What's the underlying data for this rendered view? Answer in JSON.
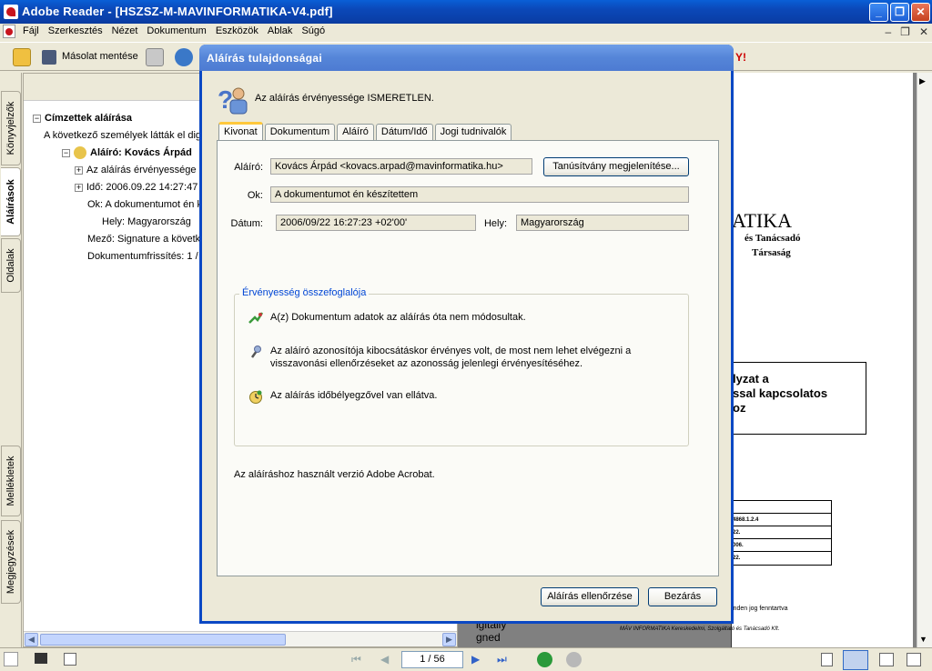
{
  "window": {
    "title": "Adobe Reader - [HSZSZ-M-MAVINFORMATIKA-V4.pdf]",
    "buttons": {
      "minimize": "_",
      "maximize": "❐",
      "close": "✕"
    }
  },
  "menu": {
    "items": [
      "Fájl",
      "Szerkesztés",
      "Nézet",
      "Dokumentum",
      "Eszközök",
      "Ablak",
      "Súgó"
    ],
    "right": [
      "–",
      "❐",
      "✕"
    ]
  },
  "toolbar": {
    "save_copy": "Másolat mentése"
  },
  "left_tabs": [
    "Könyvjelzők",
    "Aláírások",
    "Oldalak",
    "Mellékletek",
    "Megjegyzések"
  ],
  "signatures_panel": {
    "heading": "Címzettek aláírása",
    "intro": "A következő személyek látták el digi",
    "signer": "Aláíró: Kovács Árpád",
    "validity": "Az aláírás érvényessége i",
    "time": "Idő: 2006.09.22 14:27:47",
    "reason": "Ok: A dokumentumot én k",
    "location": "Hely: Magyarország",
    "field": "Mező: Signature a követk",
    "doc_revision": "Dokumentumfrissítés: 1 /"
  },
  "document_page": {
    "logo_text": "ATIKA",
    "sub1": "és Tanácsadó",
    "sub2": "Társaság",
    "box_l1": "lyzat a",
    "box_l2": "ssal kapcsolatos",
    "box_l3": "oz",
    "table_rows": [
      "4868.1.2.4",
      "22.",
      "006.",
      "22."
    ],
    "rights": "inden jog fenntartva",
    "footer_main": "MÁV INFORMATIKA Kereskedelmi, Szolgáltató és Tanácsadó Kft.",
    "stamp_l1": "igitally",
    "stamp_l2": "gned"
  },
  "statusbar": {
    "page_indicator": "1 / 56"
  },
  "dialog": {
    "title": "Aláírás tulajdonságai",
    "status": "Az aláírás érvényessége ISMERETLEN.",
    "tabs": [
      "Kivonat",
      "Dokumentum",
      "Aláíró",
      "Dátum/Idő",
      "Jogi tudnivalók"
    ],
    "signer_label": "Aláíró:",
    "signer_value": "Kovács Árpád <kovacs.arpad@mavinformatika.hu>",
    "show_cert_button": "Tanúsítvány megjelenítése...",
    "reason_label": "Ok:",
    "reason_value": "A dokumentumot én készítettem",
    "date_label": "Dátum:",
    "date_value": "2006/09/22 16:27:23 +02'00'",
    "location_label": "Hely:",
    "location_value": "Magyarország",
    "summary_legend": "Érvényesség összefoglalója",
    "summary_1": "A(z) Dokumentum adatok az aláírás óta nem módosultak.",
    "summary_2a": "Az aláíró azonosítója kibocsátáskor érvényes volt, de most nem lehet elvégezni a",
    "summary_2b": "visszavonási ellenőrzéseket az azonosság jelenlegi érvényesítéséhez.",
    "summary_3": "Az aláírás időbélyegzővel van ellátva.",
    "version_note": "Az aláíráshoz használt verzió Adobe Acrobat.",
    "verify_button": "Aláírás ellenőrzése",
    "close_button": "Bezárás"
  },
  "colors": {
    "titlebar": "#0a48b8",
    "dialog_border": "#0b48c4",
    "legend": "#0046d5",
    "active_tab_accent": "#ffc83c"
  }
}
